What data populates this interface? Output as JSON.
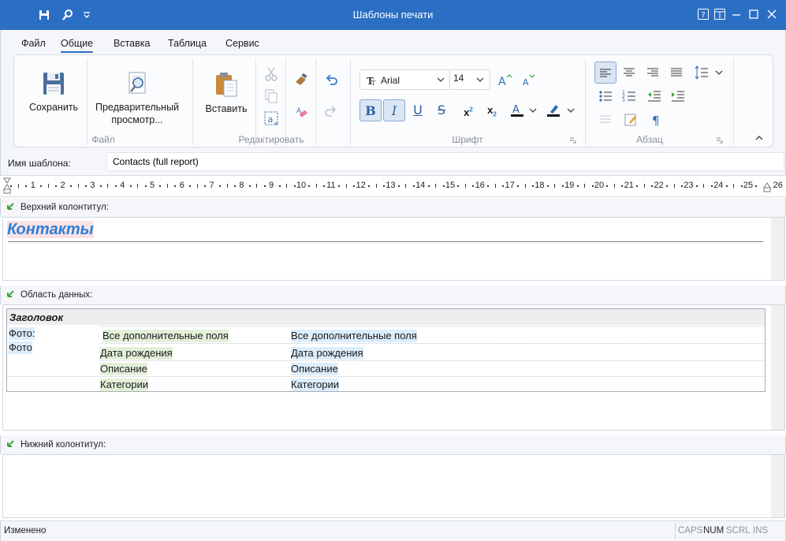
{
  "window": {
    "title": "Шаблоны печати"
  },
  "menu": {
    "tabs": [
      {
        "label": "Файл"
      },
      {
        "label": "Общие"
      },
      {
        "label": "Вставка"
      },
      {
        "label": "Таблица"
      },
      {
        "label": "Сервис"
      }
    ],
    "active_tab": "Общие"
  },
  "ribbon": {
    "file_group": {
      "label": "Файл",
      "save": "Сохранить",
      "preview_line1": "Предварительный",
      "preview_line2": "просмотр..."
    },
    "edit_group": {
      "label": "Редактировать",
      "paste": "Вставить"
    },
    "font_group": {
      "label": "Шрифт",
      "font_name": "Arial",
      "font_size": "14"
    },
    "paragraph_group": {
      "label": "Абзац"
    }
  },
  "template_name": {
    "label": "Имя шаблона:",
    "value": "Contacts (full report)"
  },
  "ruler": {
    "numbers": [
      "1",
      "2",
      "3",
      "4",
      "5",
      "6",
      "7",
      "8",
      "9",
      "10",
      "11",
      "12",
      "13",
      "14",
      "15",
      "16",
      "17",
      "18",
      "19",
      "20",
      "21",
      "22",
      "23",
      "24",
      "25",
      "26"
    ]
  },
  "sections": {
    "header": {
      "label": "Верхний колонтитул:",
      "title_text": "Контакты"
    },
    "data": {
      "label": "Область данных:",
      "table_header": "Заголовок",
      "photo_label": "Фото:",
      "photo_value": "Фото",
      "rows": [
        {
          "label": "Все дополнительные поля",
          "value": "Все дополнительные поля"
        },
        {
          "label": "Дата рождения",
          "value": "Дата рождения"
        },
        {
          "label": "Описание",
          "value": "Описание"
        },
        {
          "label": "Категории",
          "value": "Категории"
        }
      ]
    },
    "footer": {
      "label": "Нижний колонтитул:"
    }
  },
  "status": {
    "text": "Изменено",
    "indicators": {
      "caps": "CAPS",
      "num": "NUM",
      "scrl": "SCRL",
      "ins": "INS"
    }
  },
  "colors": {
    "titlebar": "#2a6fc4",
    "accent": "#2f7fd6",
    "label_green": "#e2f0d9",
    "value_blue": "#dcedfb"
  }
}
